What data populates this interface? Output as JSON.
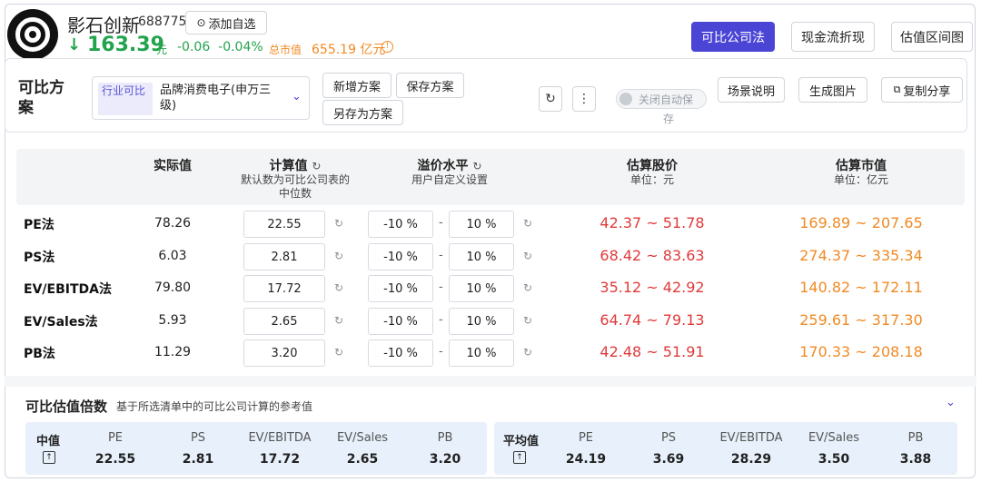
{
  "stock": {
    "name": "影石创新",
    "code": "688775",
    "add_watch": "添加自选",
    "price_arrow": "↓",
    "price": "163.39",
    "price_unit": "元",
    "change": "-0.06",
    "change_pct": "-0.04%",
    "mcap_label": "总市值",
    "mcap_value": "655.19 亿元"
  },
  "top_tabs": [
    "可比公司法",
    "现金流折现",
    "估值区间图"
  ],
  "toolbar": {
    "title": "可比方案",
    "industry_tag": "行业可比",
    "industry_value": "品牌消费电子(申万三级)",
    "new_plan": "新增方案",
    "save_plan": "保存方案",
    "save_as": "另存为方案",
    "auto_save_l1": "关闭自动保",
    "auto_save_l2": "存",
    "scene": "场景说明",
    "gen_image": "生成图片",
    "copy_share": "复制分享"
  },
  "table": {
    "h_actual": "实际值",
    "h_calc": "计算值",
    "h_calc_sub1": "默认数为可比公司表的",
    "h_calc_sub2": "中位数",
    "h_premium": "溢价水平",
    "h_premium_sub": "用户自定义设置",
    "h_price": "估算股价",
    "h_price_sub": "单位：元",
    "h_mcap": "估算市值",
    "h_mcap_sub": "单位：亿元",
    "rows": [
      {
        "name": "PE法",
        "actual": "78.26",
        "calc": "22.55",
        "low": "-10 %",
        "high": "10  %",
        "price": "42.37 ~ 51.78",
        "mcap": "169.89 ~ 207.65"
      },
      {
        "name": "PS法",
        "actual": "6.03",
        "calc": "2.81",
        "low": "-10 %",
        "high": "10  %",
        "price": "68.42 ~ 83.63",
        "mcap": "274.37 ~ 335.34"
      },
      {
        "name": "EV/EBITDA法",
        "actual": "79.80",
        "calc": "17.72",
        "low": "-10 %",
        "high": "10  %",
        "price": "35.12 ~ 42.92",
        "mcap": "140.82 ~ 172.11"
      },
      {
        "name": "EV/Sales法",
        "actual": "5.93",
        "calc": "2.65",
        "low": "-10 %",
        "high": "10  %",
        "price": "64.74 ~ 79.13",
        "mcap": "259.61 ~ 317.30"
      },
      {
        "name": "PB法",
        "actual": "11.29",
        "calc": "3.20",
        "low": "-10 %",
        "high": "10  %",
        "price": "42.48 ~ 51.91",
        "mcap": "170.33 ~ 208.18"
      }
    ]
  },
  "multiples": {
    "title": "可比估值倍数",
    "subtitle": "基于所选清单中的可比公司计算的参考值",
    "median": {
      "label": "中值",
      "headers": [
        "PE",
        "PS",
        "EV/EBITDA",
        "EV/Sales",
        "PB"
      ],
      "values": [
        "22.55",
        "2.81",
        "17.72",
        "2.65",
        "3.20"
      ]
    },
    "average": {
      "label": "平均值",
      "headers": [
        "PE",
        "PS",
        "EV/EBITDA",
        "EV/Sales",
        "PB"
      ],
      "values": [
        "24.19",
        "3.69",
        "28.29",
        "3.50",
        "3.88"
      ]
    }
  }
}
